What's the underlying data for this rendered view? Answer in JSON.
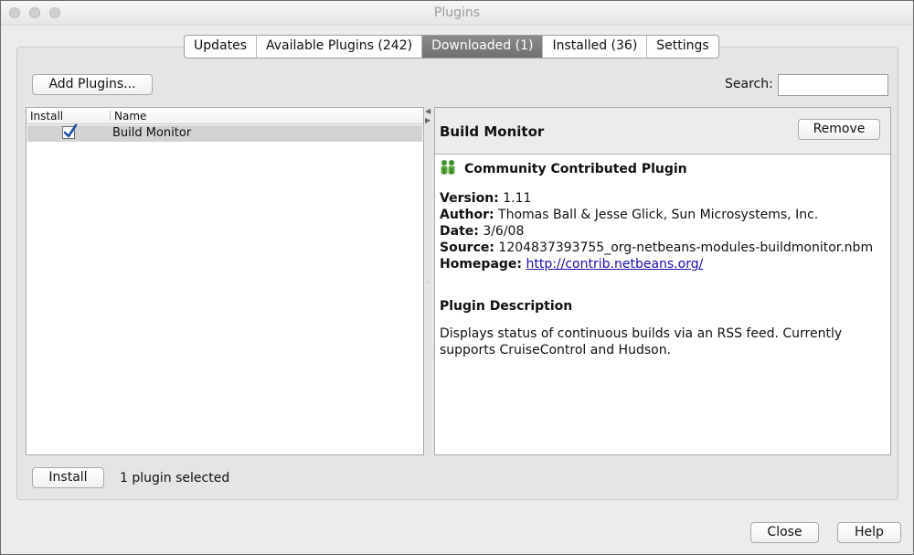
{
  "window": {
    "title": "Plugins"
  },
  "tabs": [
    {
      "label": "Updates"
    },
    {
      "label": "Available Plugins (242)"
    },
    {
      "label": "Downloaded (1)"
    },
    {
      "label": "Installed (36)"
    },
    {
      "label": "Settings"
    }
  ],
  "active_tab": "Downloaded (1)",
  "toolbar": {
    "add_plugins_label": "Add Plugins...",
    "search_label": "Search:",
    "search_value": ""
  },
  "list": {
    "columns": [
      "Install",
      "Name"
    ],
    "rows": [
      {
        "checked": true,
        "name": "Build Monitor"
      }
    ]
  },
  "detail": {
    "title": "Build Monitor",
    "remove_label": "Remove",
    "badge": "Community Contributed Plugin",
    "badge_icon": "people-icon",
    "version_label": "Version:",
    "version": "1.11",
    "author_label": "Author:",
    "author": "Thomas Ball & Jesse Glick, Sun Microsystems, Inc.",
    "date_label": "Date:",
    "date": "3/6/08",
    "source_label": "Source:",
    "source": "1204837393755_org-netbeans-modules-buildmonitor.nbm",
    "homepage_label": "Homepage:",
    "homepage": "http://contrib.netbeans.org/",
    "description_title": "Plugin Description",
    "description": "Displays status of continuous builds via an RSS feed. Currently supports CruiseControl and Hudson."
  },
  "footer": {
    "install_label": "Install",
    "status": "1 plugin selected",
    "close_label": "Close",
    "help_label": "Help"
  },
  "colors": {
    "active_tab_bg": "#7d7d7d",
    "link": "#1a0dab",
    "selected_row": "#d2d2d2",
    "checkmark": "#1f4fa8"
  }
}
